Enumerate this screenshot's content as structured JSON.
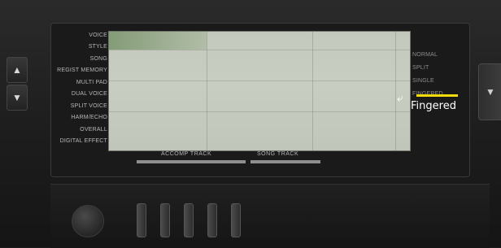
{
  "left_labels": [
    "VOICE",
    "STYLE",
    "SONG",
    "REGIST MEMORY",
    "MULTI PAD",
    "DUAL VOICE",
    "SPLIT VOICE",
    "HARM/ECHO",
    "OVERALL",
    "DIGITAL EFFECT"
  ],
  "right_labels": [
    "NORMAL",
    "SPLIT",
    "SINGLE",
    "FINGERED"
  ],
  "tracks": {
    "accomp": "ACCOMP TRACK",
    "song": "SONG TRACK"
  },
  "buttons": {
    "left_up": "▲",
    "left_down": "▼",
    "right": "▼"
  },
  "annotation": {
    "text": "Fingered",
    "highlight_color": "#f2dc0c"
  }
}
